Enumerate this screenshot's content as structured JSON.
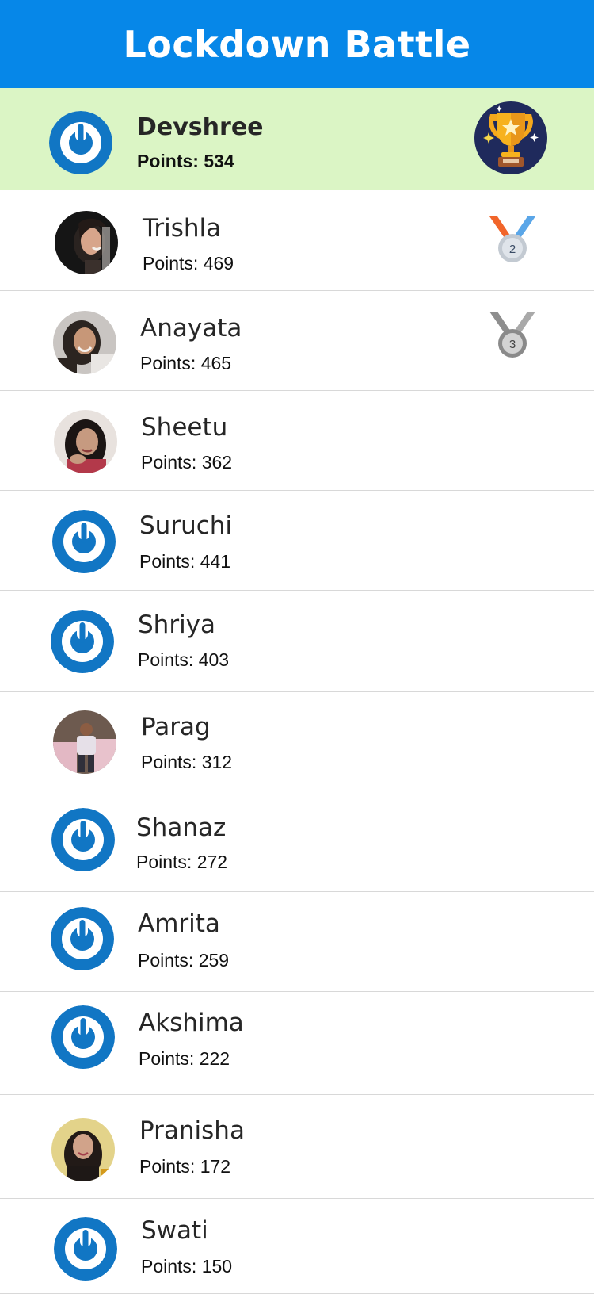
{
  "app": {
    "title": "Lockdown Battle"
  },
  "leaderboard": [
    {
      "name": "Devshree",
      "points": "Points: 534",
      "avatar": "default-avatar-icon",
      "badge": "trophy-icon"
    },
    {
      "name": "Trishla",
      "points": "Points: 469",
      "avatar": "profile-photo",
      "badge": "medal-2-icon",
      "badge_text": "2"
    },
    {
      "name": "Anayata",
      "points": "Points: 465",
      "avatar": "profile-photo",
      "badge": "medal-3-icon",
      "badge_text": "3"
    },
    {
      "name": "Sheetu",
      "points": "Points: 362",
      "avatar": "profile-photo"
    },
    {
      "name": "Suruchi",
      "points": "Points: 441",
      "avatar": "default-avatar-icon"
    },
    {
      "name": "Shriya",
      "points": "Points: 403",
      "avatar": "default-avatar-icon"
    },
    {
      "name": "Parag",
      "points": "Points: 312",
      "avatar": "profile-photo"
    },
    {
      "name": "Shanaz",
      "points": "Points: 272",
      "avatar": "default-avatar-icon"
    },
    {
      "name": "Amrita",
      "points": "Points: 259",
      "avatar": "default-avatar-icon"
    },
    {
      "name": "Akshima",
      "points": "Points: 222",
      "avatar": "default-avatar-icon"
    },
    {
      "name": "Pranisha",
      "points": "Points: 172",
      "avatar": "profile-photo"
    },
    {
      "name": "Swati",
      "points": "Points: 150",
      "avatar": "default-avatar-icon"
    }
  ],
  "colors": {
    "header": "#0687e8",
    "top_row": "#dbf5c5",
    "avatar_blue": "#1176c4"
  }
}
